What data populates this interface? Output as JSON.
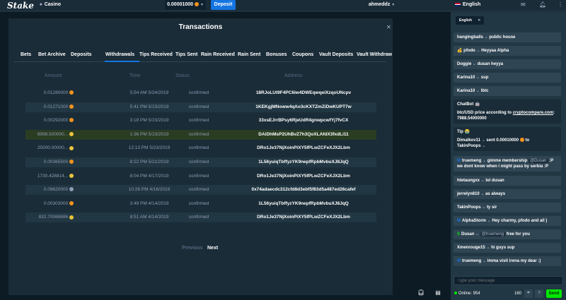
{
  "header": {
    "brand": "Stake",
    "nav_casino": "Casino",
    "balance": "0.00001000",
    "deposit_label": "Deposit",
    "username": "ahmeddz",
    "language": "English",
    "colors": {
      "accent": "#1475e1",
      "btc": "#f7931a"
    }
  },
  "modal": {
    "title": "Transactions",
    "tabs": [
      "Bets",
      "Bet Archive",
      "Deposits",
      "Withdrawals",
      "Tips Received",
      "Tips Sent",
      "Rain Received",
      "Rain Sent",
      "Bonuses",
      "Coupons",
      "Vault Deposits",
      "Vault Withdraw"
    ],
    "active_tab": "Withdrawals",
    "columns": {
      "amount": "Amount",
      "time": "Time",
      "status": "Status",
      "address": "Address"
    },
    "rows": [
      {
        "amount": "0.01280000",
        "coin": "btc",
        "time": "5:54 AM 5/24/2019",
        "status": "confirmed",
        "address": "18RJoLUt9F4PC6iw4DWEqwqeiXzqoUNcpv"
      },
      {
        "amount": "0.01271000",
        "coin": "btc",
        "time": "5:41 PM 5/23/2019",
        "status": "confirmed",
        "address": "1KEKgjMNoww4qAo3cKXTZmZiDwKUPT7w"
      },
      {
        "amount": "0.00292000",
        "coin": "btc",
        "time": "3:18 PM 5/23/2019",
        "status": "confirmed",
        "address": "33xsEJrrBPsy6RjeUdR4gnwpcwfYj7fvCX"
      },
      {
        "amount": "8998.500000...",
        "coin": "doge",
        "time": "1:36 PM 5/23/2019",
        "status": "confirmed",
        "address": "DAiDhMsP2UhBvZ7h3QoXLAfdX3fxdLi11"
      },
      {
        "amount": "25000.00000...",
        "coin": "doge",
        "time": "12:13 PM 5/23/2019",
        "status": "confirmed",
        "address": "DRo1Je37NjXoinPiXY5fPLwZCFeXJX2Lbm"
      },
      {
        "amount": "0.00365500",
        "coin": "btc",
        "time": "8:22 PM 5/21/2019",
        "status": "confirmed",
        "address": "1L56yuiqTbffyzYK9nepfRpbMvbuXJ8JqQ"
      },
      {
        "amount": "1730.428814...",
        "coin": "doge",
        "time": "8:04 PM 4/17/2019",
        "status": "confirmed",
        "address": "DRo1Je37NjXoinPiXY5fPLwZCFeXJX2Lbm"
      },
      {
        "amount": "0.09620000",
        "coin": "eth",
        "time": "10:26 PM 4/16/2019",
        "status": "confirmed",
        "address": "0x74adaecdc312cfd8d3ebf5f83d5a487ed26cafef"
      },
      {
        "amount": "0.00303000",
        "coin": "btc",
        "time": "3:49 PM 4/14/2019",
        "status": "confirmed",
        "address": "1L56yuiqTbffyzYK9nepfRpbMvbuXJ8JqQ"
      },
      {
        "amount": "832.70068686",
        "coin": "doge",
        "time": "8:51 AM 4/14/2019",
        "status": "confirmed",
        "address": "DRo1Je37NjXoinPiXY5fPLwZCFeXJX2Lbm"
      }
    ],
    "pagination": {
      "previous": "Previous",
      "next": "Next"
    }
  },
  "chat": {
    "language_tag": "English",
    "messages": [
      {
        "user": "hangingballs",
        "text": "public house"
      },
      {
        "prefix": "💰",
        "user": "pfodo",
        "text": "Heyyaa Alpha"
      },
      {
        "user": "Doggie",
        "text": "dusan heyya"
      },
      {
        "user": "Karina10",
        "text": "sup"
      },
      {
        "user": "Karina10",
        "text": "lbtc"
      },
      {
        "user": "ChatBot 🤖",
        "line1": "btc/USD price according to",
        "link": "cryptocompare.com",
        "line2": "7988.54000000"
      },
      {
        "user": "Tip 😭",
        "l1_user": "Dimalkov11",
        "l1_text": "sent 0.00010000",
        "l2_text": "to",
        "l3_user": "TakinPoops"
      },
      {
        "badge": "M",
        "user": "truemeng",
        "text": "gimme membership",
        "mention": "@Dusan",
        "text2": ":P",
        "line2": "we dont know when i might pass by serbia :P"
      },
      {
        "user": "htetaungxx",
        "text": "lol dusan"
      },
      {
        "user": "jerrelyn810",
        "text": "as always"
      },
      {
        "user": "TakinPoops",
        "text": "ty sir"
      },
      {
        "badge": "M",
        "user": "AlphaStorm",
        "text": "Hey charmy, pfodo and all )"
      },
      {
        "badge": "S",
        "user": "Dusan",
        "mention": "@truemeng",
        "text": "free for you"
      },
      {
        "user": "Xmenrouge15",
        "text": "hi guys sup"
      },
      {
        "badge": "M",
        "user": "truemeng",
        "text": "imma visit irena my dear :)"
      }
    ],
    "input_placeholder": "Type your message",
    "online_label": "Online: 954",
    "char_count": "160",
    "send_label": "Send"
  }
}
